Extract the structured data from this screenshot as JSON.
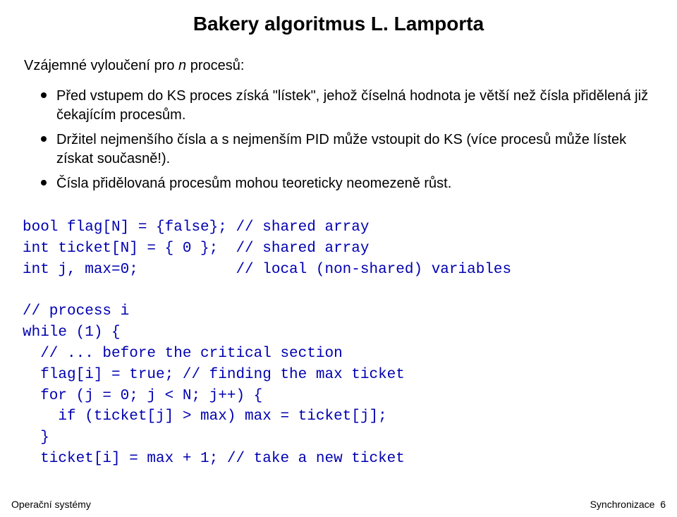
{
  "title": "Bakery algoritmus L. Lamporta",
  "intro_prefix": "Vzájemné vyloučení pro ",
  "intro_italic": "n",
  "intro_suffix": " procesů:",
  "bullets": [
    "Před vstupem do KS proces získá \"lístek\", jehož číselná hodnota je větší než čísla přidělená již čekajícím procesům.",
    "Držitel nejmenšího čísla a s nejmenším PID může vstoupit do KS (více procesů může lístek získat současně!).",
    "Čísla přidělovaná procesům mohou teoreticky neomezeně růst."
  ],
  "code": "bool flag[N] = {false}; // shared array\nint ticket[N] = { 0 };  // shared array\nint j, max=0;           // local (non-shared) variables\n\n// process i\nwhile (1) {\n  // ... before the critical section\n  flag[i] = true; // finding the max ticket\n  for (j = 0; j < N; j++) {\n    if (ticket[j] > max) max = ticket[j];\n  }\n  ticket[i] = max + 1; // take a new ticket",
  "footer_left": "Operační systémy",
  "footer_right_label": "Synchronizace",
  "footer_right_page": "6"
}
